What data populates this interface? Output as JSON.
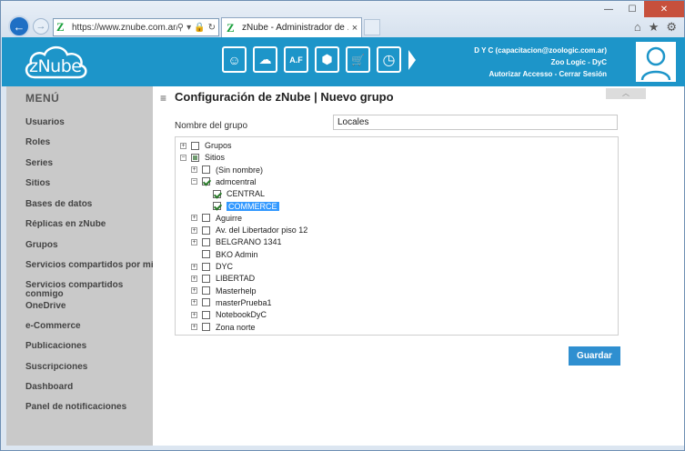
{
  "browser": {
    "address": "https://www.znube.com.ar/Acc",
    "tab_title": "zNube - Administrador de ...",
    "tab_close": "×"
  },
  "header": {
    "brand": "zNube",
    "user_line1": "D Y C (capacitacion@zoologic.com.ar)",
    "user_line2": "Zoo Logic - DyC",
    "user_links": "Autorizar Accesso - Cerrar Sesión",
    "modules": [
      {
        "icon": "users-circle-icon",
        "glyph": "☺"
      },
      {
        "icon": "cloud-gear-icon",
        "glyph": "☁"
      },
      {
        "icon": "af-icon",
        "glyph": "A.F"
      },
      {
        "icon": "cube-icon",
        "glyph": "⬢"
      },
      {
        "icon": "cart-icon",
        "glyph": "🛒"
      },
      {
        "icon": "clock-icon",
        "glyph": "◷"
      }
    ]
  },
  "sidebar": {
    "title": "MENÚ",
    "items": [
      "Usuarios",
      "Roles",
      "Series",
      "Sitios",
      "Bases de datos",
      "Réplicas en zNube",
      "Grupos",
      "Servicios compartidos por mi",
      "Servicios compartidos conmigo",
      "OneDrive",
      "e-Commerce",
      "Publicaciones",
      "Suscripciones",
      "Dashboard",
      "Panel de notificaciones"
    ]
  },
  "main": {
    "title": "Configuración de zNube | Nuevo grupo",
    "group_label": "Nombre del grupo",
    "group_value": "Locales",
    "save_label": "Guardar",
    "tree": [
      {
        "label": "Grupos",
        "level": 0,
        "exp": "+",
        "state": "none"
      },
      {
        "label": "Sitios",
        "level": 0,
        "exp": "−",
        "state": "partial"
      },
      {
        "label": "(Sin nombre)",
        "level": 1,
        "exp": "+",
        "state": "none"
      },
      {
        "label": "admcentral",
        "level": 1,
        "exp": "−",
        "state": "checked"
      },
      {
        "label": "CENTRAL",
        "level": 2,
        "exp": "",
        "state": "checked"
      },
      {
        "label": "COMMERCE",
        "level": 2,
        "exp": "",
        "state": "checked",
        "selected": true
      },
      {
        "label": "Aguirre",
        "level": 1,
        "exp": "+",
        "state": "none"
      },
      {
        "label": "Av. del Libertador piso 12",
        "level": 1,
        "exp": "+",
        "state": "none"
      },
      {
        "label": "BELGRANO 1341",
        "level": 1,
        "exp": "+",
        "state": "none"
      },
      {
        "label": "BKO Admin",
        "level": 1,
        "exp": "",
        "state": "none"
      },
      {
        "label": "DYC",
        "level": 1,
        "exp": "+",
        "state": "none"
      },
      {
        "label": "LIBERTAD",
        "level": 1,
        "exp": "+",
        "state": "none"
      },
      {
        "label": "Masterhelp",
        "level": 1,
        "exp": "+",
        "state": "none"
      },
      {
        "label": "masterPrueba1",
        "level": 1,
        "exp": "+",
        "state": "none"
      },
      {
        "label": "NotebookDyC",
        "level": 1,
        "exp": "+",
        "state": "none"
      },
      {
        "label": "Zona norte",
        "level": 1,
        "exp": "+",
        "state": "none"
      }
    ]
  }
}
